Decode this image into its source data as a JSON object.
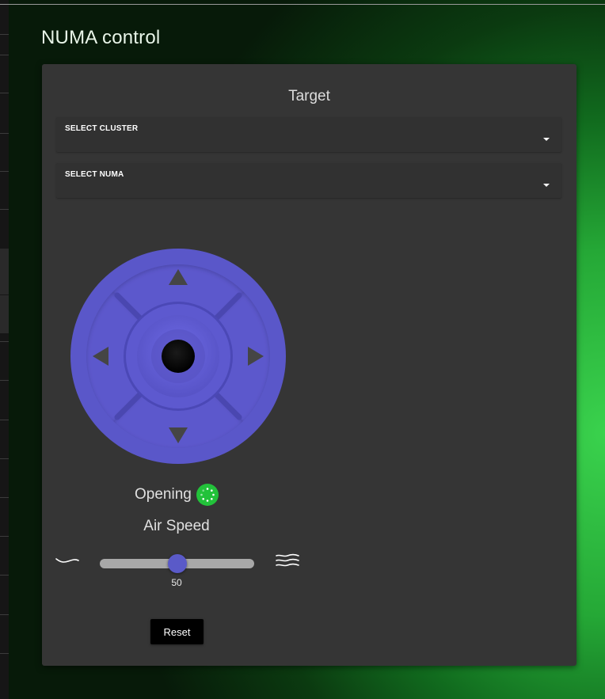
{
  "app": {
    "title": "NUMA control"
  },
  "target": {
    "title": "Target"
  },
  "selects": {
    "cluster": {
      "label": "SELECT CLUSTER",
      "value": ""
    },
    "numa": {
      "label": "SELECT NUMA",
      "value": ""
    }
  },
  "joystick": {
    "up_icon": "triangle-up-icon",
    "down_icon": "triangle-down-icon",
    "left_icon": "triangle-left-icon",
    "right_icon": "triangle-right-icon",
    "colors": {
      "pad": "#5c58cc",
      "outer": "#5a57c9",
      "stick": "#000000"
    }
  },
  "status": {
    "text": "Opening",
    "icon": "spinner-icon",
    "color": "#22c23a"
  },
  "air_speed": {
    "label": "Air Speed",
    "value": 50,
    "display_value": "50",
    "min": 0,
    "max": 100,
    "slow_icon": "wind-slow-icon",
    "fast_icon": "wind-fast-icon"
  },
  "actions": {
    "reset_label": "Reset"
  },
  "colors": {
    "panel": "#353535",
    "accent": "#5a5ac8",
    "background_glow": "#3ad24d"
  }
}
